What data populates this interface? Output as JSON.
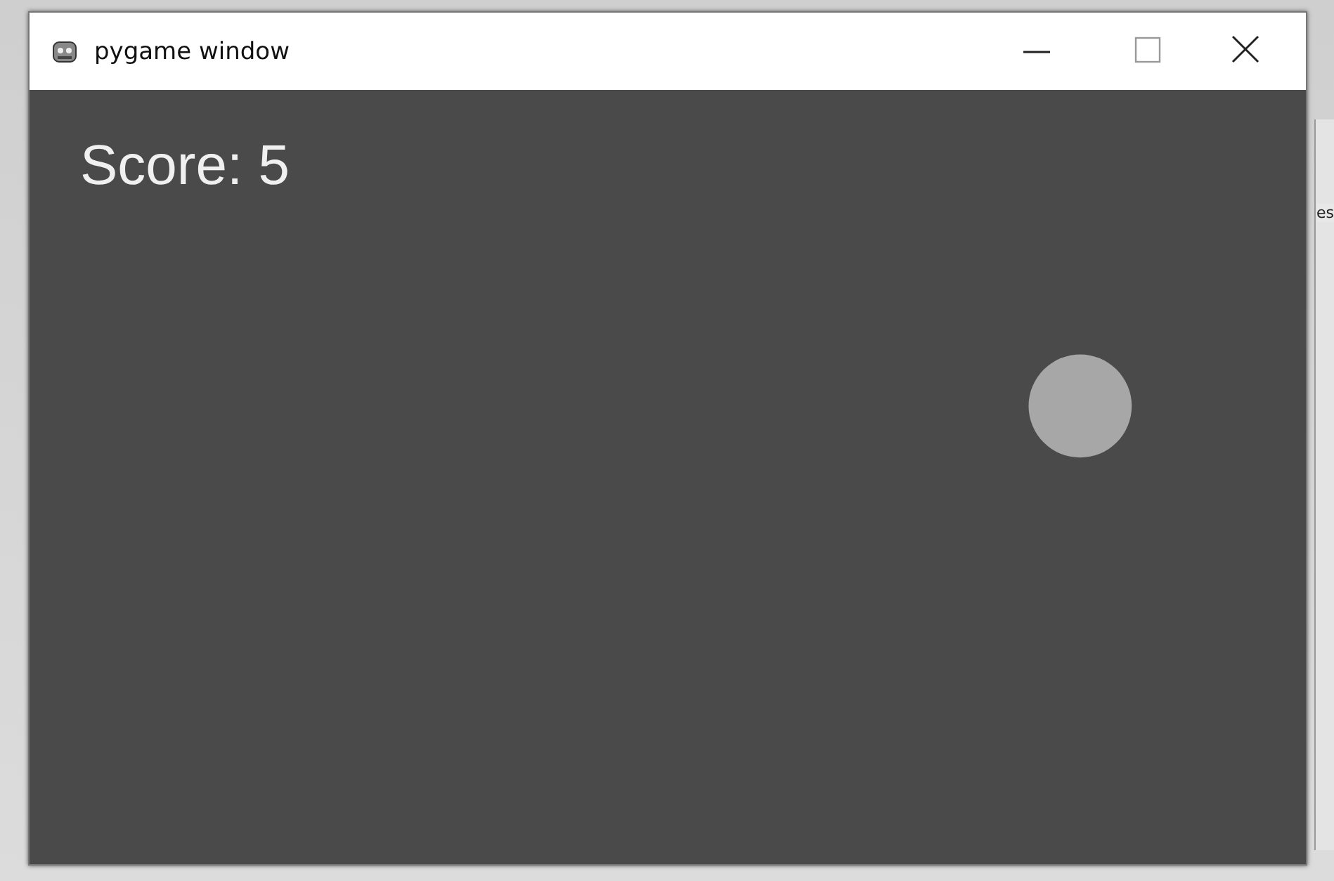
{
  "window": {
    "title": "pygame window"
  },
  "game": {
    "score_text": "Score: 5"
  },
  "background_window": {
    "text_fragment": "es"
  }
}
